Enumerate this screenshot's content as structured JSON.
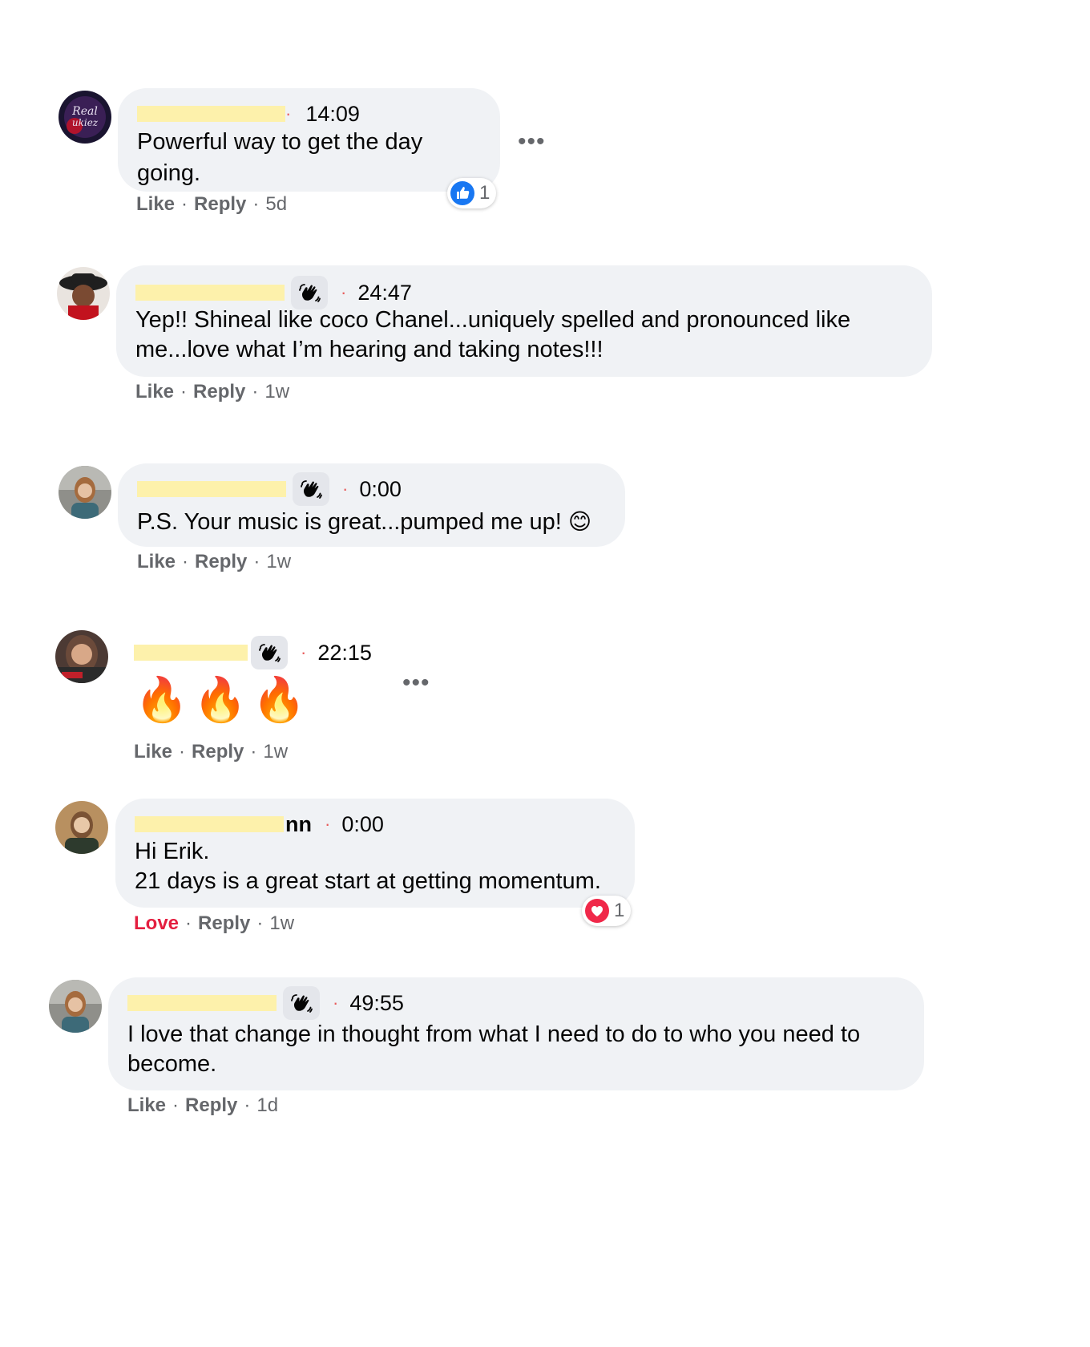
{
  "comments": [
    {
      "time": "14:09",
      "text": "Powerful way to get the day going.",
      "actions": {
        "like": "Like",
        "reply": "Reply",
        "age": "5d"
      },
      "reaction": {
        "icon": "like-icon",
        "count": "1"
      },
      "more": "•••"
    },
    {
      "time": "24:47",
      "text": "Yep!! Shineal like coco Chanel...uniquely spelled and pronounced like me...love what I’m hearing and taking notes!!!",
      "actions": {
        "like": "Like",
        "reply": "Reply",
        "age": "1w"
      }
    },
    {
      "time": "0:00",
      "text": "P.S. Your music is great...pumped me up! ",
      "emoji": "😊",
      "actions": {
        "like": "Like",
        "reply": "Reply",
        "age": "1w"
      }
    },
    {
      "time": "22:15",
      "emoji": "🔥",
      "actions": {
        "like": "Like",
        "reply": "Reply",
        "age": "1w"
      },
      "more": "•••"
    },
    {
      "name_tail": "nn",
      "time": "0:00",
      "text_line1": "Hi Erik.",
      "text_line2": "21 days is a great start at getting momentum.",
      "actions": {
        "like": "Love",
        "reply": "Reply",
        "age": "1w"
      },
      "reaction": {
        "icon": "love-icon",
        "count": "1"
      }
    },
    {
      "time": "49:55",
      "text": "I love that change in thought from what I need to do to who you need to become.",
      "actions": {
        "like": "Like",
        "reply": "Reply",
        "age": "1d"
      }
    }
  ],
  "separators": {
    "dot": "·"
  },
  "colors": {
    "bubble": "#f0f2f5",
    "highlight": "#fdf1ab",
    "love": "#e41e3f",
    "like_blue": "#1877f2",
    "muted": "#65676b"
  }
}
